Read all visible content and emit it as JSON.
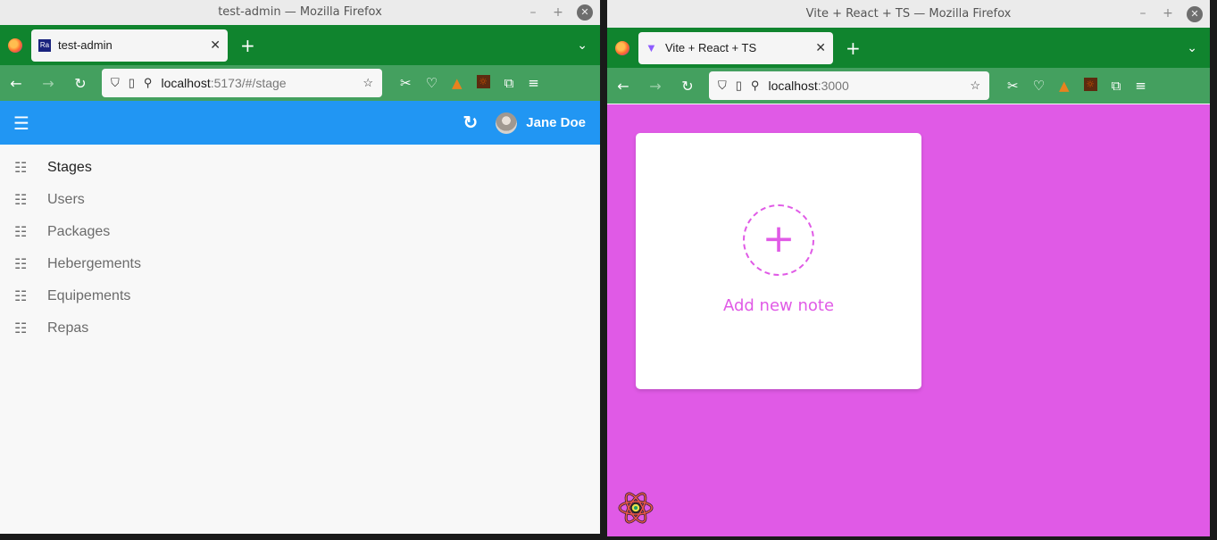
{
  "left_window": {
    "title": "test-admin — Mozilla Firefox",
    "tab_title": "test-admin",
    "url_host": "localhost",
    "url_rest": ":5173/#/stage",
    "user_name": "Jane Doe",
    "menu": [
      {
        "label": "Stages",
        "active": true
      },
      {
        "label": "Users"
      },
      {
        "label": "Packages"
      },
      {
        "label": "Hebergements"
      },
      {
        "label": "Equipements"
      },
      {
        "label": "Repas"
      }
    ]
  },
  "right_window": {
    "title": "Vite + React + TS — Mozilla Firefox",
    "tab_title": "Vite + React + TS",
    "url_host": "localhost",
    "url_rest": ":3000",
    "add_note_label": "Add new note"
  },
  "colors": {
    "firefox_tabbar": "#10842e",
    "firefox_navbar": "#44a05f",
    "admin_appbar": "#2196f3",
    "notes_background": "#e05ae6"
  },
  "icons": {
    "window_controls": [
      "minimize-icon",
      "maximize-icon",
      "close-icon"
    ],
    "nav": [
      "back-icon",
      "forward-icon",
      "reload-icon"
    ],
    "menu_item": "list-icon"
  }
}
